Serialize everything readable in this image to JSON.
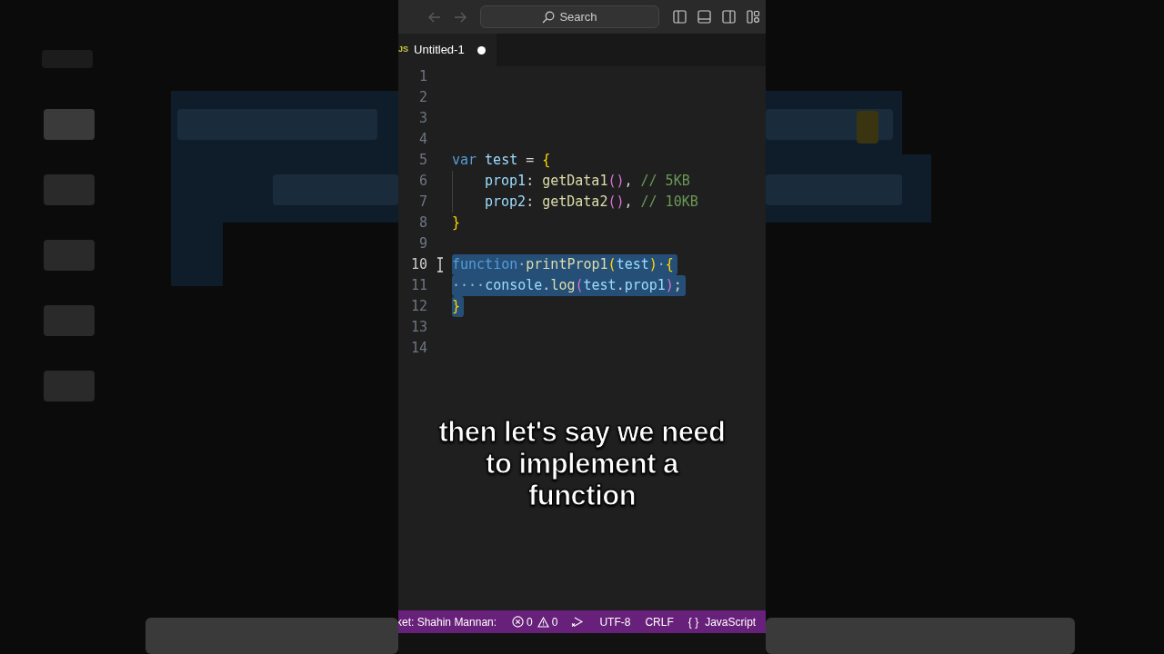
{
  "title_bar": {
    "back_disabled": true,
    "forward_disabled": true,
    "search": {
      "placeholder": "Search"
    }
  },
  "tabs": [
    {
      "icon_text": "JS",
      "label": "Untitled-1",
      "modified": true,
      "selected": true
    }
  ],
  "editor": {
    "lines": [
      {
        "number": "1",
        "current": false,
        "selected": false
      },
      {
        "number": "2",
        "current": false,
        "selected": false
      },
      {
        "number": "3",
        "current": false,
        "selected": false
      },
      {
        "number": "4",
        "current": false,
        "selected": false
      },
      {
        "number": "5",
        "current": false,
        "selected": false,
        "tokens": [
          {
            "text": "var",
            "kind": "keyword"
          },
          {
            "text": "test",
            "kind": "variable",
            "space_before": true
          },
          {
            "text": "=",
            "kind": "plain",
            "space_before": true
          },
          {
            "text": "{",
            "kind": "brace",
            "space_before": true
          }
        ]
      },
      {
        "number": "6",
        "current": false,
        "selected": false,
        "indented": true,
        "tokens": [
          {
            "text": "prop1",
            "kind": "variable"
          },
          {
            "text": ":",
            "kind": "plain"
          },
          {
            "text": "getData1",
            "kind": "function",
            "space_before": true
          },
          {
            "text": "()",
            "kind": "paren"
          },
          {
            "text": ",",
            "kind": "plain"
          },
          {
            "text": "// 5KB",
            "kind": "comment",
            "space_before": true
          }
        ]
      },
      {
        "number": "7",
        "current": false,
        "selected": false,
        "indented": true,
        "tokens": [
          {
            "text": "prop2",
            "kind": "variable"
          },
          {
            "text": ":",
            "kind": "plain"
          },
          {
            "text": "getData2",
            "kind": "function",
            "space_before": true
          },
          {
            "text": "()",
            "kind": "paren"
          },
          {
            "text": ",",
            "kind": "plain"
          },
          {
            "text": "// 10KB",
            "kind": "comment",
            "space_before": true
          }
        ]
      },
      {
        "number": "8",
        "current": false,
        "selected": false,
        "tokens": [
          {
            "text": "}",
            "kind": "brace"
          }
        ]
      },
      {
        "number": "9",
        "current": false,
        "selected": false
      },
      {
        "number": "10",
        "current": true,
        "selected": true,
        "tokens": [
          {
            "text": "function",
            "kind": "keyword"
          },
          {
            "text": "·",
            "kind": "whitespace"
          },
          {
            "text": "printProp1",
            "kind": "function"
          },
          {
            "text": "(",
            "kind": "paren2"
          },
          {
            "text": "test",
            "kind": "variable"
          },
          {
            "text": ")",
            "kind": "paren2"
          },
          {
            "text": "·",
            "kind": "whitespace"
          },
          {
            "text": "{",
            "kind": "brace"
          }
        ]
      },
      {
        "number": "11",
        "current": false,
        "selected": true,
        "tokens": [
          {
            "text": "····",
            "kind": "whitespace"
          },
          {
            "text": "console",
            "kind": "variable"
          },
          {
            "text": ".",
            "kind": "plain"
          },
          {
            "text": "log",
            "kind": "function"
          },
          {
            "text": "(",
            "kind": "paren"
          },
          {
            "text": "test",
            "kind": "variable"
          },
          {
            "text": ".",
            "kind": "plain"
          },
          {
            "text": "prop1",
            "kind": "variable"
          },
          {
            "text": ")",
            "kind": "paren"
          },
          {
            "text": ";",
            "kind": "plain"
          }
        ]
      },
      {
        "number": "12",
        "current": false,
        "selected": true,
        "tokens": [
          {
            "text": "}",
            "kind": "brace"
          }
        ]
      },
      {
        "number": "13",
        "current": false,
        "selected": false
      },
      {
        "number": "14",
        "current": false,
        "selected": false
      }
    ]
  },
  "caption": "then let's say we need to implement a function",
  "status_bar": {
    "account": "ket: Shahin Mannan:",
    "errors": "0",
    "warnings": "0",
    "encoding": "UTF-8",
    "line_ending": "CRLF",
    "language_icon": "{ }",
    "language": "JavaScript"
  }
}
